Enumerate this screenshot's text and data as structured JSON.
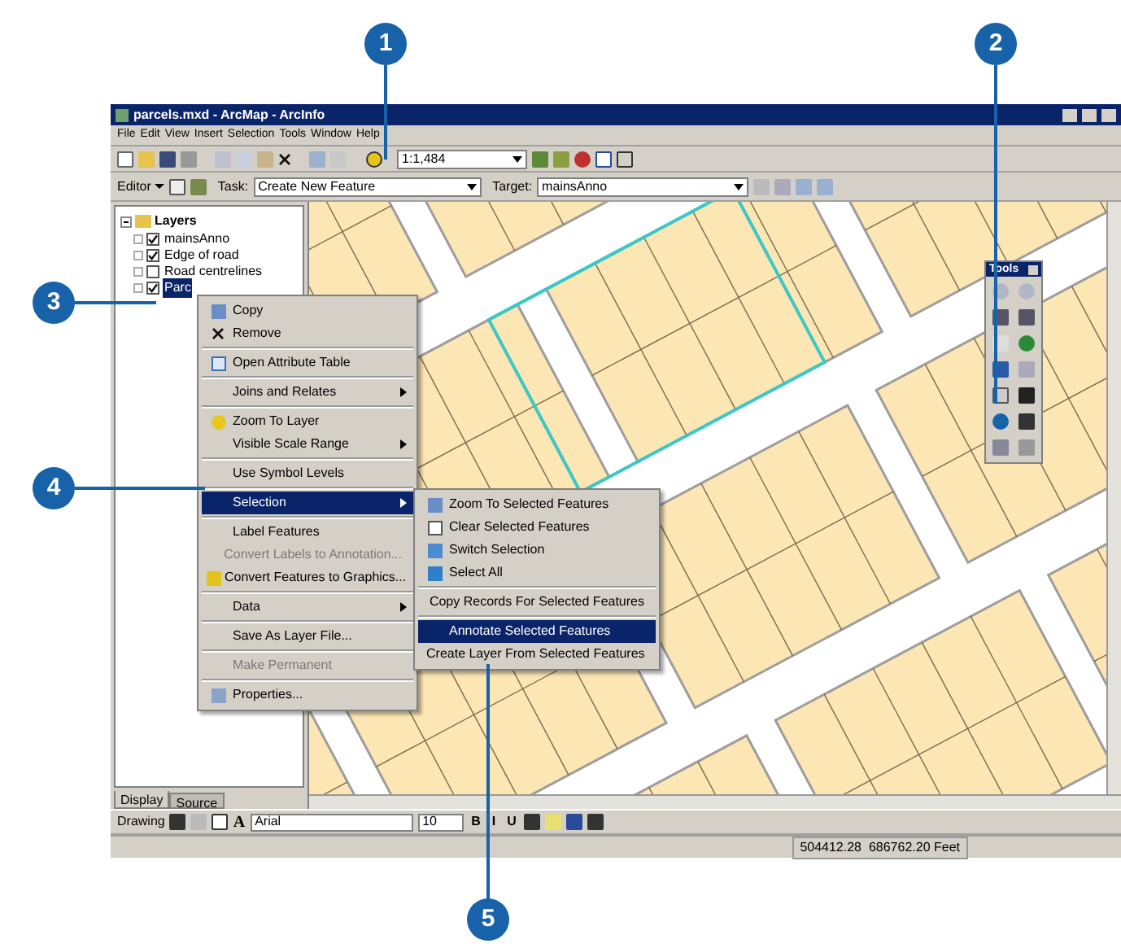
{
  "callouts": [
    {
      "number": "1"
    },
    {
      "number": "2"
    },
    {
      "number": "3"
    },
    {
      "number": "4"
    },
    {
      "number": "5"
    }
  ],
  "window": {
    "title": "parcels.mxd - ArcMap - ArcInfo"
  },
  "menu_bar": [
    "File",
    "Edit",
    "View",
    "Insert",
    "Selection",
    "Tools",
    "Window",
    "Help"
  ],
  "standard_toolbar": {
    "scale": "1:1,484"
  },
  "editor_toolbar": {
    "editor_menu": "Editor",
    "task_label": "Task:",
    "task": "Create New Feature",
    "target_label": "Target:",
    "target": "mainsAnno"
  },
  "toc": {
    "root": {
      "label": "Layers",
      "expanded": true,
      "children": [
        {
          "label": "mainsAnno",
          "checked": true,
          "selected": false
        },
        {
          "label": "Edge of road",
          "checked": true,
          "selected": false
        },
        {
          "label": "Road centrelines",
          "checked": false,
          "selected": false
        },
        {
          "label": "Parc",
          "checked": true,
          "selected": true
        }
      ]
    },
    "tabs": [
      {
        "label": "Display",
        "selected": true
      },
      {
        "label": "Source",
        "selected": false
      }
    ]
  },
  "context_menu": {
    "items": [
      {
        "kind": "item",
        "label": "Copy",
        "disabled": false,
        "selected": false,
        "submenu": false
      },
      {
        "kind": "item",
        "label": "Remove",
        "disabled": false,
        "selected": false,
        "submenu": false
      },
      {
        "kind": "separator"
      },
      {
        "kind": "item",
        "label": "Open Attribute Table",
        "disabled": false,
        "selected": false,
        "submenu": false
      },
      {
        "kind": "separator"
      },
      {
        "kind": "item",
        "label": "Joins and Relates",
        "disabled": false,
        "selected": false,
        "submenu": true
      },
      {
        "kind": "separator"
      },
      {
        "kind": "item",
        "label": "Zoom To Layer",
        "disabled": false,
        "selected": false,
        "submenu": false
      },
      {
        "kind": "item",
        "label": "Visible Scale Range",
        "disabled": false,
        "selected": false,
        "submenu": true
      },
      {
        "kind": "separator"
      },
      {
        "kind": "item",
        "label": "Use Symbol Levels",
        "disabled": false,
        "selected": false,
        "submenu": false
      },
      {
        "kind": "separator"
      },
      {
        "kind": "item",
        "label": "Selection",
        "disabled": false,
        "selected": true,
        "submenu": true
      },
      {
        "kind": "separator"
      },
      {
        "kind": "item",
        "label": "Label Features",
        "disabled": false,
        "selected": false,
        "submenu": false
      },
      {
        "kind": "item",
        "label": "Convert Labels to Annotation...",
        "disabled": true,
        "selected": false,
        "submenu": false
      },
      {
        "kind": "item",
        "label": "Convert Features to Graphics...",
        "disabled": false,
        "selected": false,
        "submenu": false
      },
      {
        "kind": "separator"
      },
      {
        "kind": "item",
        "label": "Data",
        "disabled": false,
        "selected": false,
        "submenu": true
      },
      {
        "kind": "separator"
      },
      {
        "kind": "item",
        "label": "Save As Layer File...",
        "disabled": false,
        "selected": false,
        "submenu": false
      },
      {
        "kind": "separator"
      },
      {
        "kind": "item",
        "label": "Make Permanent",
        "disabled": true,
        "selected": false,
        "submenu": false
      },
      {
        "kind": "separator"
      },
      {
        "kind": "item",
        "label": "Properties...",
        "disabled": false,
        "selected": false,
        "submenu": false
      }
    ]
  },
  "submenu": {
    "items": [
      {
        "kind": "item",
        "label": "Zoom To Selected Features",
        "disabled": false,
        "selected": false,
        "submenu": false
      },
      {
        "kind": "item",
        "label": "Clear Selected Features",
        "disabled": false,
        "selected": false,
        "submenu": false
      },
      {
        "kind": "item",
        "label": "Switch Selection",
        "disabled": false,
        "selected": false,
        "submenu": false
      },
      {
        "kind": "item",
        "label": "Select All",
        "disabled": false,
        "selected": false,
        "submenu": false
      },
      {
        "kind": "separator"
      },
      {
        "kind": "item",
        "label": "Copy Records For Selected Features",
        "disabled": false,
        "selected": false,
        "submenu": false
      },
      {
        "kind": "separator"
      },
      {
        "kind": "item",
        "label": "Annotate Selected Features",
        "disabled": false,
        "selected": true,
        "submenu": false
      },
      {
        "kind": "item",
        "label": "Create Layer From Selected Features",
        "disabled": false,
        "selected": false,
        "submenu": false
      }
    ]
  },
  "tools_palette": {
    "title": "Tools"
  },
  "drawing_toolbar": {
    "menu": "Drawing",
    "text_tool": "A",
    "font": "Arial",
    "size": "10",
    "format_buttons": [
      "B",
      "I",
      "U"
    ]
  },
  "status_bar": {
    "coordinates": "504412.28  686762.20 Feet"
  }
}
